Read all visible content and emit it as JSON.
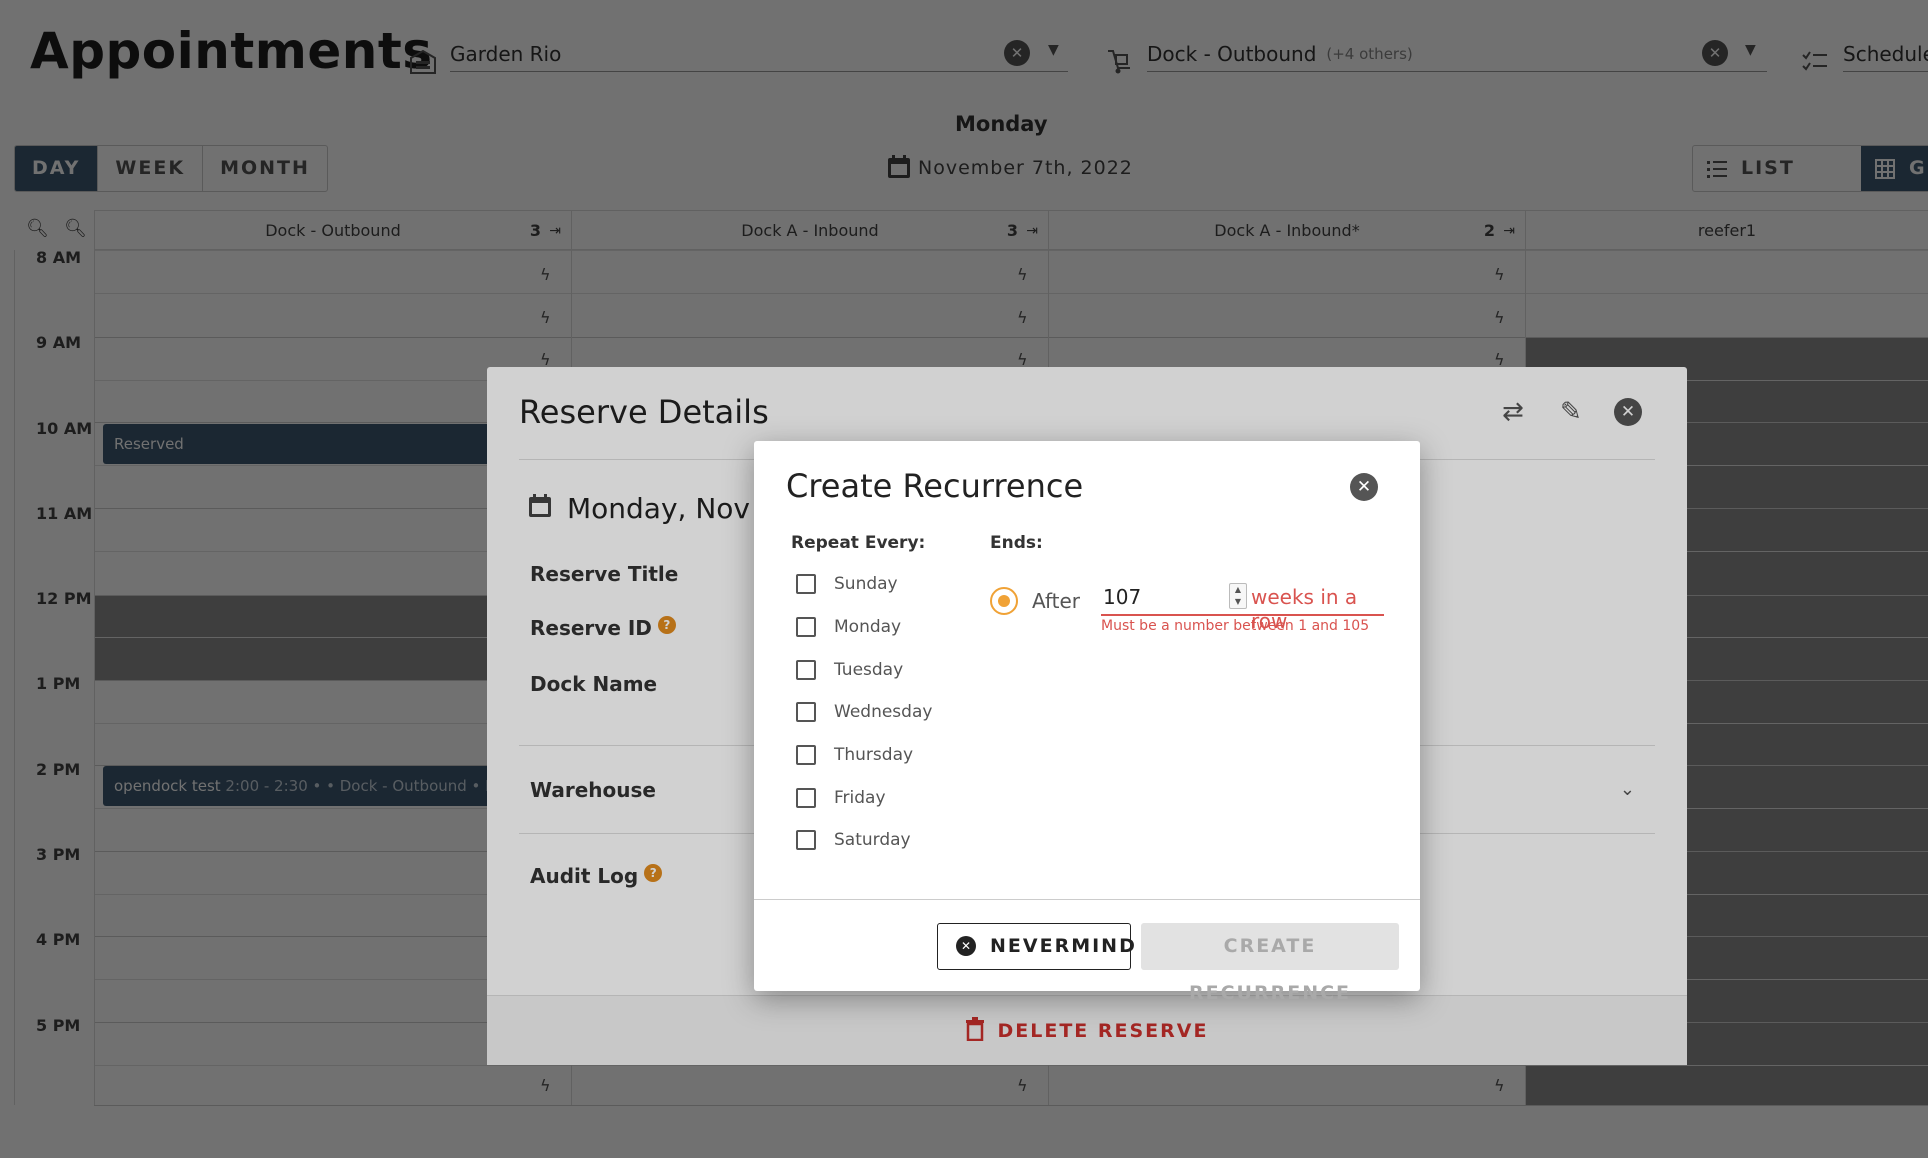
{
  "app": {
    "title": "Appointments"
  },
  "filters": {
    "warehouse": {
      "value": "Garden Rio"
    },
    "dock": {
      "value": "Dock - Outbound",
      "more": "(+4 others)"
    },
    "schedule": {
      "value": "Schedule"
    }
  },
  "view_modes": {
    "day": "DAY",
    "week": "WEEK",
    "month": "MONTH",
    "active": "DAY"
  },
  "date": {
    "day_name": "Monday",
    "date_text": "November 7th, 2022"
  },
  "display_modes": {
    "list": "LIST VIEW",
    "grid": "GI"
  },
  "columns": [
    {
      "name": "Dock - Outbound",
      "count": "3"
    },
    {
      "name": "Dock A - Inbound",
      "count": "3"
    },
    {
      "name": "Dock A - Inbound*",
      "count": "2"
    },
    {
      "name": "reefer1",
      "count": ""
    }
  ],
  "times": [
    "8 AM",
    "9 AM",
    "10 AM",
    "11 AM",
    "12 PM",
    "1 PM",
    "2 PM",
    "3 PM",
    "4 PM",
    "5 PM"
  ],
  "appointments": [
    {
      "title": "Reserved",
      "detail": ""
    },
    {
      "title": "opendock test",
      "detail": "2:00 - 2:30 •  • Dock - Outbound • FTL"
    }
  ],
  "reserve_details": {
    "title": "Reserve Details",
    "date": "Monday, Nov 7,",
    "fields": {
      "reserve_title": "Reserve Title",
      "reserve_id": "Reserve ID",
      "dock_name": "Dock Name",
      "warehouse": "Warehouse",
      "audit_log": "Audit Log"
    },
    "help_glyph": "?",
    "delete_label": "DELETE RESERVE"
  },
  "create_recurrence": {
    "title": "Create Recurrence",
    "repeat_label": "Repeat Every:",
    "ends_label": "Ends:",
    "days": [
      {
        "label": "Sunday",
        "checked": false
      },
      {
        "label": "Monday",
        "checked": false
      },
      {
        "label": "Tuesday",
        "checked": false
      },
      {
        "label": "Wednesday",
        "checked": false
      },
      {
        "label": "Thursday",
        "checked": false
      },
      {
        "label": "Friday",
        "checked": false
      },
      {
        "label": "Saturday",
        "checked": false
      }
    ],
    "after_label": "After",
    "after_value": "107",
    "after_suffix": "weeks in a row",
    "error": "Must be a number between 1 and 105",
    "nevermind_label": "NEVERMIND",
    "create_label": "CREATE RECURRENCE"
  },
  "colors": {
    "primary": "#3d5a73",
    "accent": "#f0a236",
    "error": "#d9534f",
    "delete": "#c9302c"
  }
}
